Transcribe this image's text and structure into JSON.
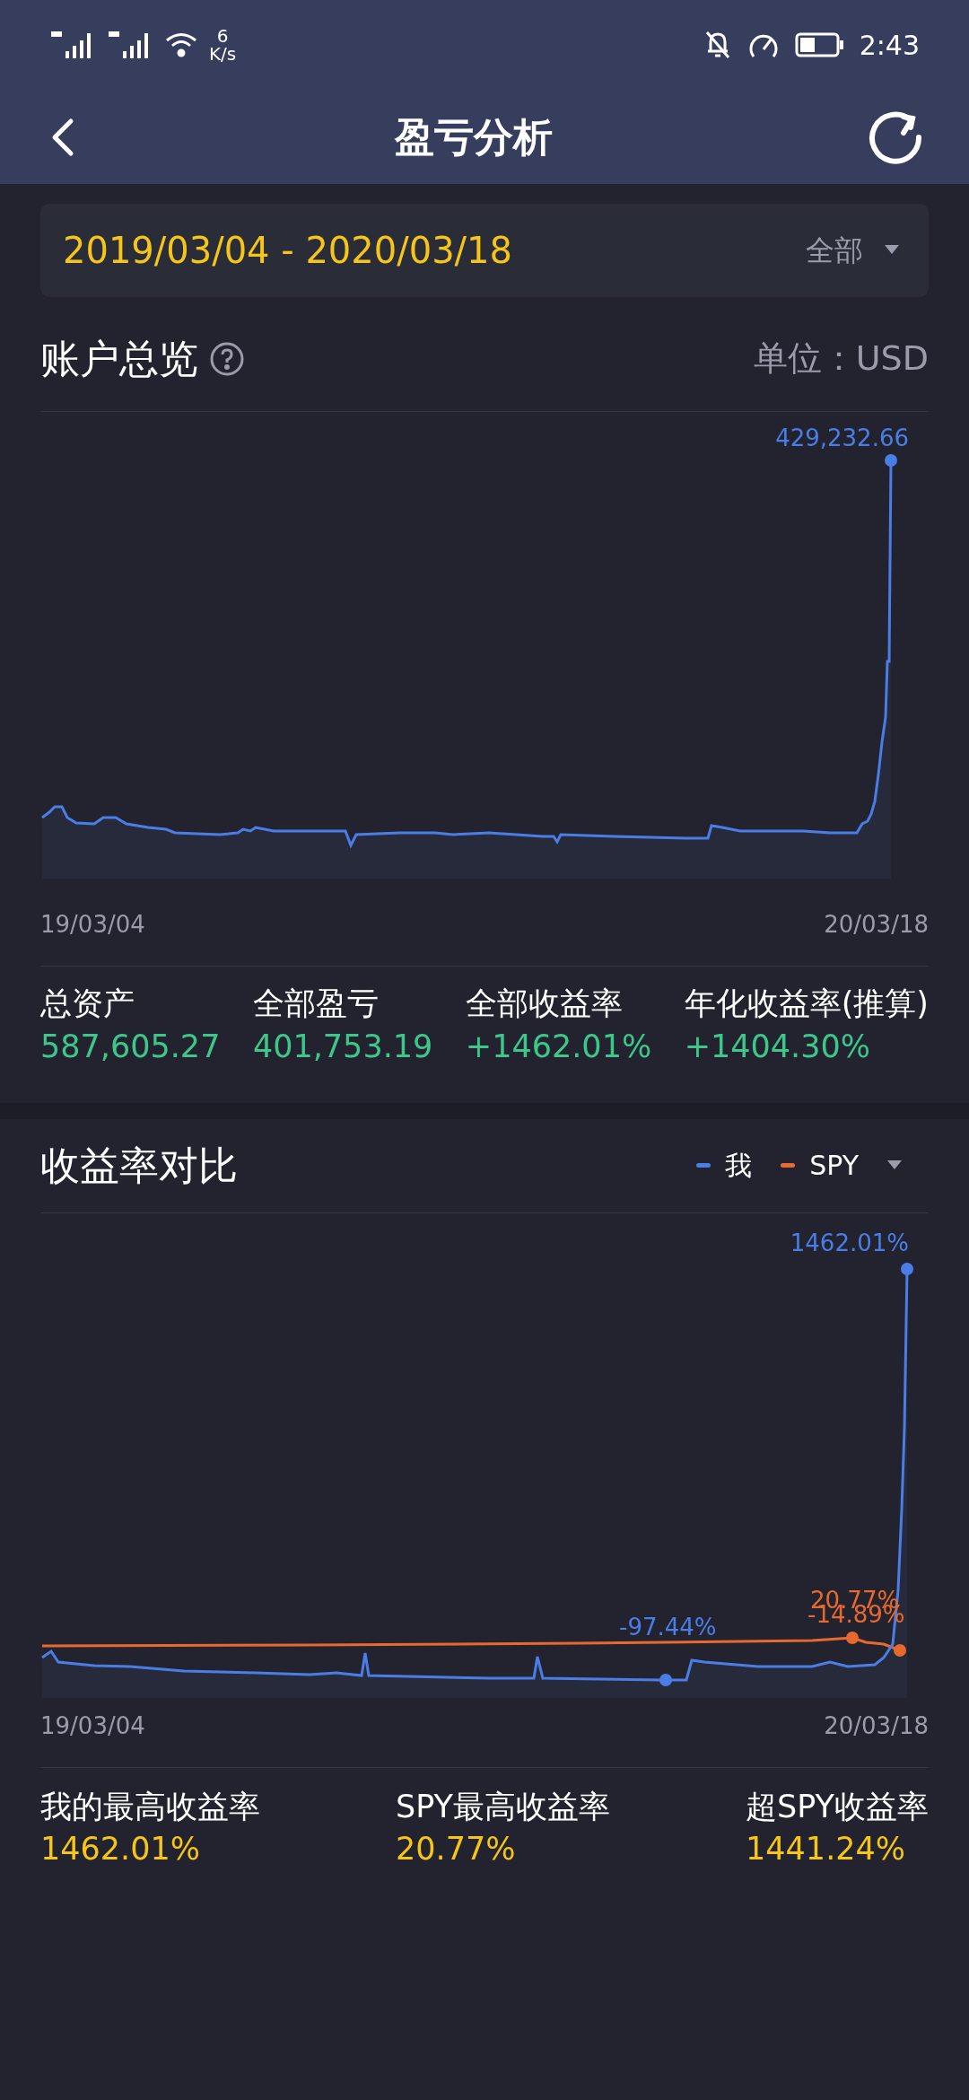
{
  "status_bar": {
    "speed_value": "6",
    "speed_unit": "K/s",
    "time": "2:43"
  },
  "header": {
    "title": "盈亏分析"
  },
  "date_range": {
    "value": "2019/03/04 - 2020/03/18",
    "filter": "全部"
  },
  "overview": {
    "title": "账户总览",
    "unit": "单位：USD",
    "peak_label": "429,232.66",
    "x_start": "19/03/04",
    "x_end": "20/03/18",
    "stats": [
      {
        "label": "总资产",
        "value": "587,605.27"
      },
      {
        "label": "全部盈亏",
        "value": "401,753.19"
      },
      {
        "label": "全部收益率",
        "value": "+1462.01%"
      },
      {
        "label": "年化收益率(推算)",
        "value": "+1404.30%"
      }
    ]
  },
  "comparison": {
    "title": "收益率对比",
    "legend": [
      {
        "name": "我",
        "color": "#4a7ee6",
        "dropdown": false
      },
      {
        "name": "SPY",
        "color": "#e8692f",
        "dropdown": true
      }
    ],
    "point_labels": [
      {
        "text": "1462.01%",
        "color": "#4a7ee6"
      },
      {
        "text": "20.77%",
        "color": "#e8692f"
      },
      {
        "text": "-97.44%",
        "color": "#4a7ee6"
      },
      {
        "text": "-14.89%",
        "color": "#e8692f"
      }
    ],
    "x_start": "19/03/04",
    "x_end": "20/03/18",
    "stats": [
      {
        "label": "我的最高收益率",
        "value": "1462.01%"
      },
      {
        "label": "SPY最高收益率",
        "value": "20.77%"
      },
      {
        "label": "超SPY收益率",
        "value": "1441.24%"
      }
    ]
  }
}
